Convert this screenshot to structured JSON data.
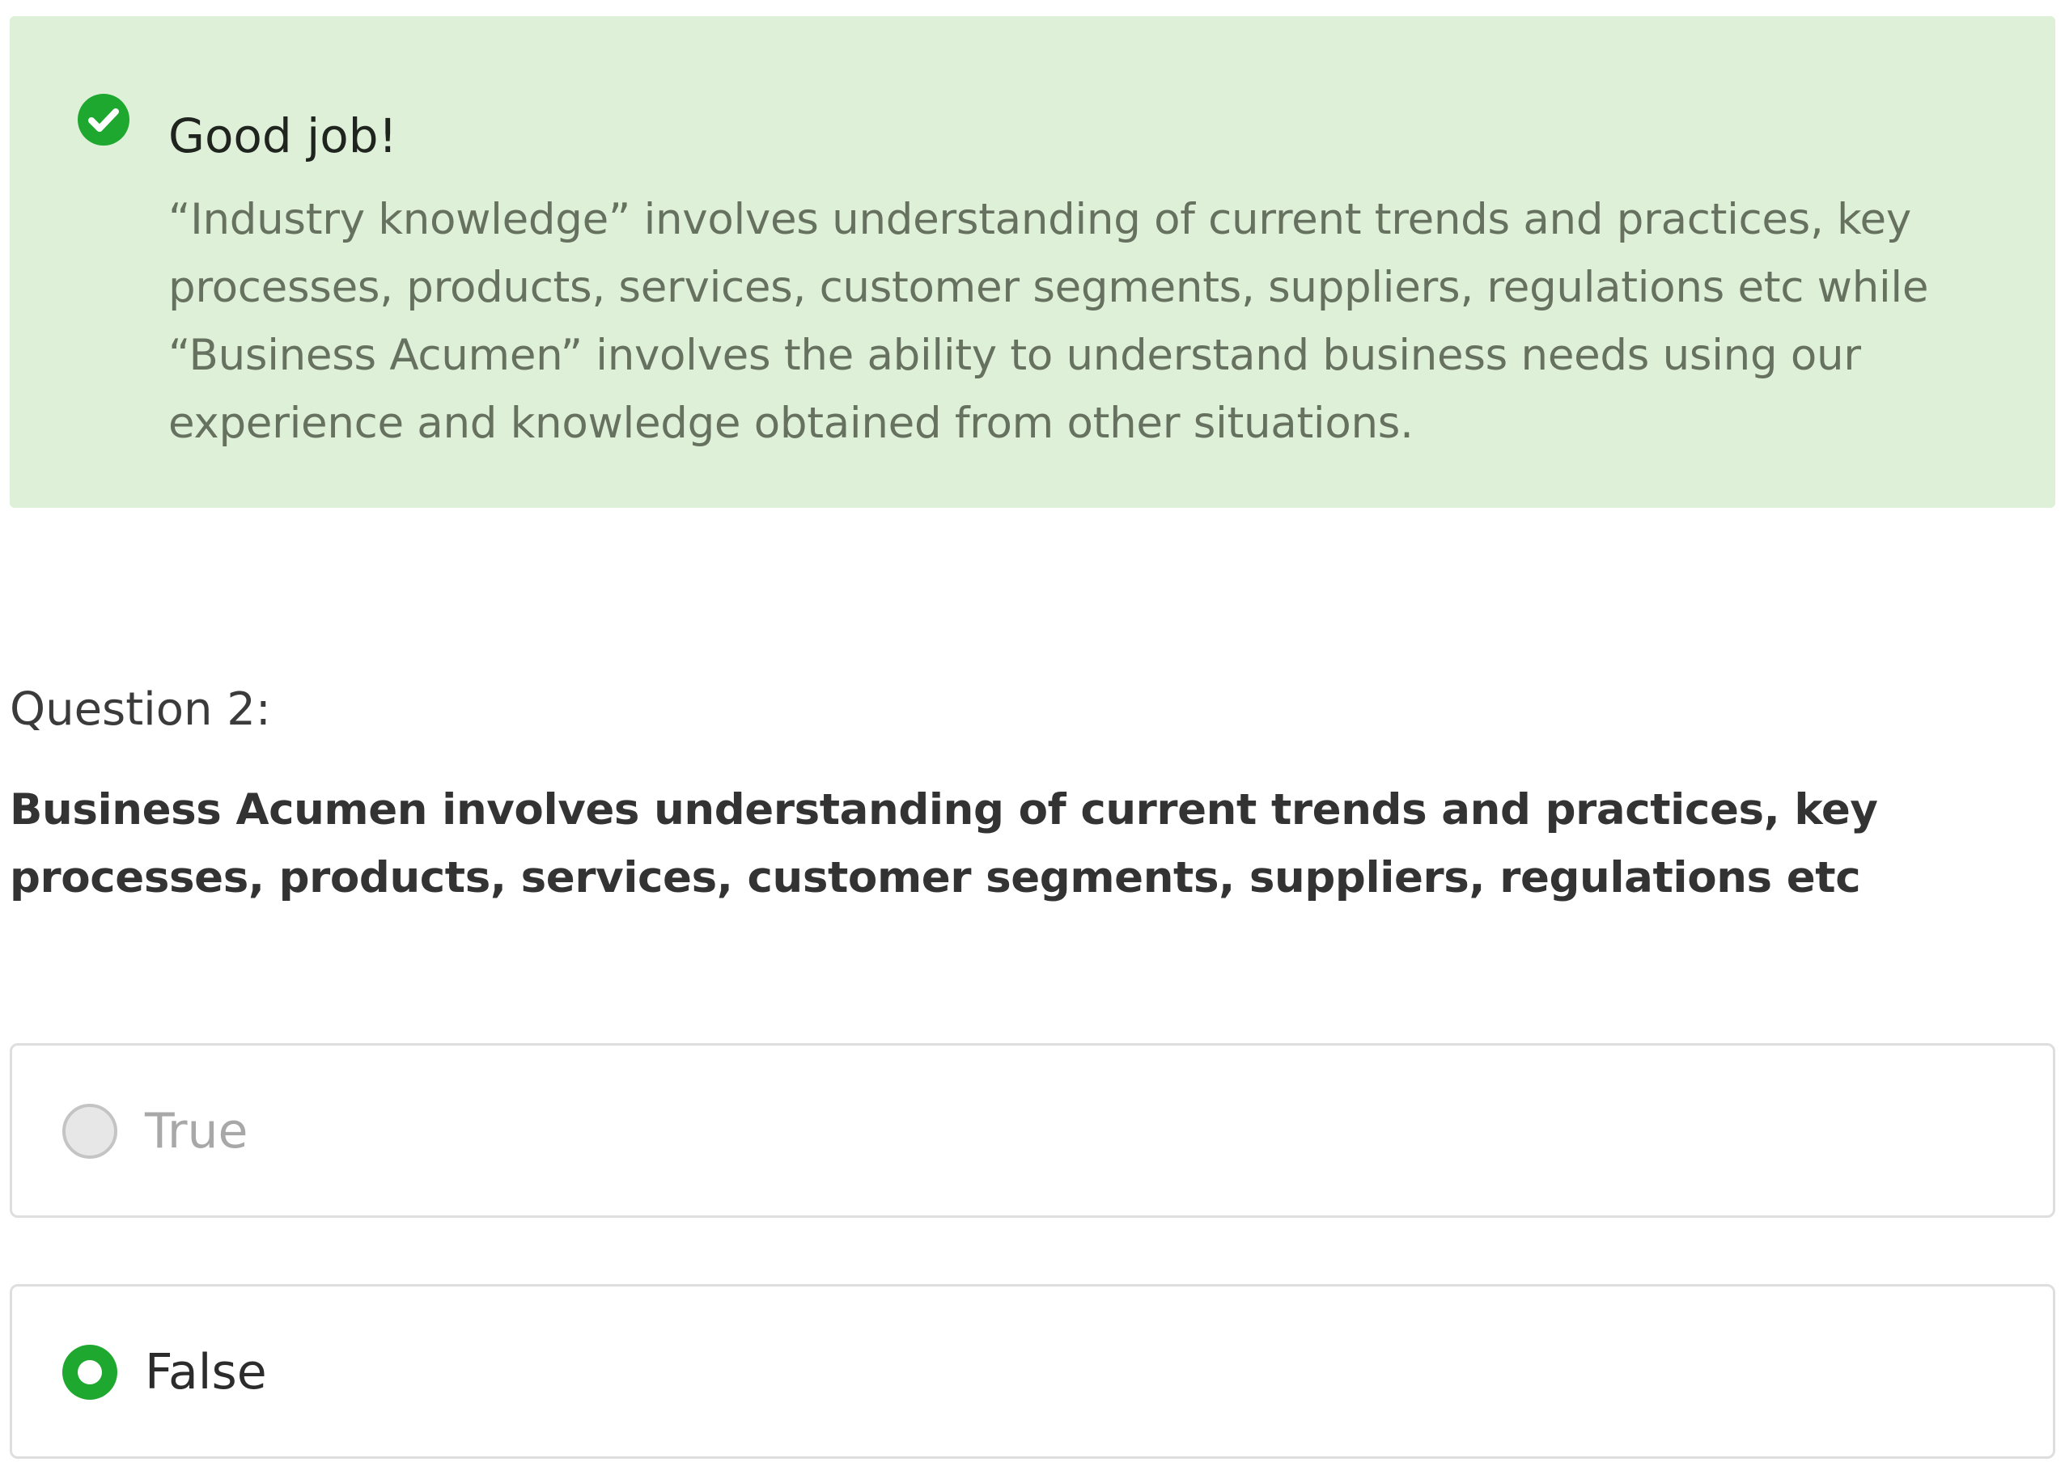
{
  "feedback": {
    "icon": "check-circle-icon",
    "status_color": "#1fa82f",
    "background_color": "#dff0d8",
    "title": "Good job!",
    "explanation": "“Industry knowledge” involves understanding of current trends and practices, key processes, products, services, customer segments, suppliers, regulations etc while “Business Acumen” involves the ability to understand business needs using our experience and knowledge obtained from other situations."
  },
  "question": {
    "number_label": "Question 2:",
    "text": "Business Acumen involves understanding of current trends and practices, key processes, products, services, customer segments, suppliers, regulations etc"
  },
  "options": [
    {
      "label": "True",
      "selected": false
    },
    {
      "label": "False",
      "selected": true
    }
  ]
}
